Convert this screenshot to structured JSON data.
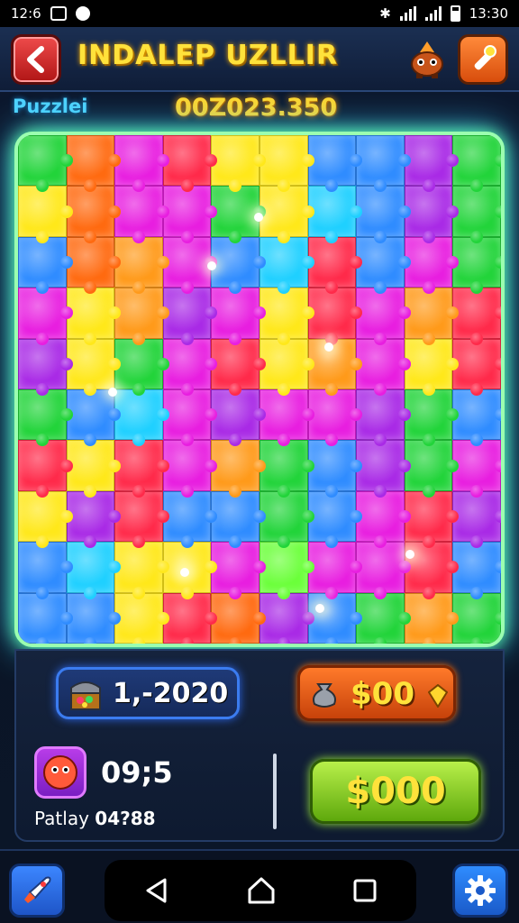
{
  "status_bar": {
    "time_left": "12:6",
    "time_right": "13:30"
  },
  "header": {
    "title": "INDALEP UZLLIR",
    "back_icon": "back-arrow-icon",
    "character_icon": "creature-icon",
    "tool_icon": "tool-icon"
  },
  "subheader": {
    "label": "Puzzlei",
    "score": "00Z023.350"
  },
  "board": {
    "columns": 10,
    "rows": 10,
    "colors": [
      "#22d43a",
      "#ff6a10",
      "#e81ee0",
      "#ffe81a",
      "#2f8cff",
      "#a92ae6",
      "#ff2a4a",
      "#1fd0ff",
      "#ff9a1a",
      "#6bff3a"
    ],
    "grid": [
      [
        0,
        1,
        2,
        6,
        3,
        3,
        4,
        4,
        5,
        0
      ],
      [
        3,
        1,
        2,
        2,
        0,
        3,
        7,
        4,
        5,
        0
      ],
      [
        4,
        1,
        8,
        2,
        4,
        7,
        6,
        4,
        2,
        0
      ],
      [
        2,
        3,
        8,
        5,
        2,
        3,
        6,
        2,
        8,
        6
      ],
      [
        5,
        3,
        0,
        2,
        6,
        3,
        8,
        2,
        3,
        6
      ],
      [
        0,
        4,
        7,
        2,
        5,
        2,
        2,
        5,
        0,
        4
      ],
      [
        6,
        3,
        6,
        2,
        8,
        0,
        4,
        5,
        0,
        2
      ],
      [
        3,
        5,
        6,
        4,
        4,
        0,
        4,
        2,
        6,
        5
      ],
      [
        4,
        7,
        3,
        3,
        2,
        9,
        2,
        2,
        6,
        4
      ],
      [
        4,
        4,
        3,
        6,
        1,
        5,
        4,
        0,
        8,
        0
      ]
    ]
  },
  "panel": {
    "level": "1,-2020",
    "coin_button_label": "$00",
    "timer": "09;5",
    "player_label": "Patlay",
    "player_value": "04?88",
    "buy_button_label": "$000"
  },
  "colors": {
    "title_yellow": "#ffe23b",
    "accent_cyan": "#4fd2ff",
    "board_glow": "#5effa0"
  },
  "nav": {
    "left_icon": "rocket-icon",
    "right_icon": "gear-icon",
    "system": [
      "back-triangle-icon",
      "home-icon",
      "recents-icon"
    ]
  }
}
